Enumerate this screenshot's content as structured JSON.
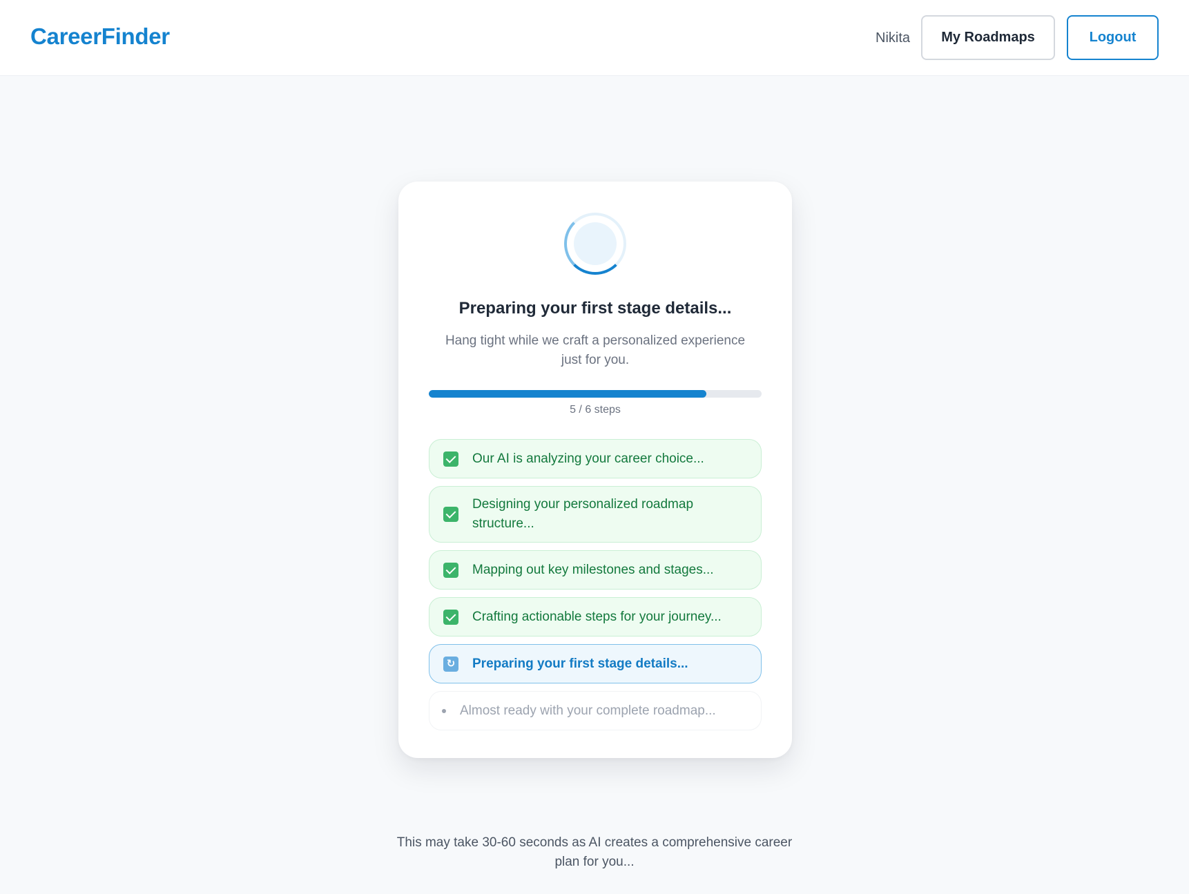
{
  "header": {
    "brand": "CareerFinder",
    "user_name": "Nikita",
    "my_roadmaps_label": "My Roadmaps",
    "logout_label": "Logout"
  },
  "loader": {
    "title": "Preparing your first stage details...",
    "subtitle": "Hang tight while we craft a personalized experience just for you.",
    "progress": {
      "completed": 5,
      "total": 6,
      "fraction": 0.833,
      "label": "5 / 6 steps"
    },
    "steps": [
      {
        "label": "Our AI is analyzing your career choice...",
        "status": "done",
        "icon": "check-icon"
      },
      {
        "label": "Designing your personalized roadmap structure...",
        "status": "done",
        "icon": "check-icon"
      },
      {
        "label": "Mapping out key milestones and stages...",
        "status": "done",
        "icon": "check-icon"
      },
      {
        "label": "Crafting actionable steps for your journey...",
        "status": "done",
        "icon": "check-icon"
      },
      {
        "label": "Preparing your first stage details...",
        "status": "active",
        "icon": "refresh-icon"
      },
      {
        "label": "Almost ready with your complete roadmap...",
        "status": "pending",
        "icon": "bullet-icon"
      }
    ]
  },
  "footer": {
    "note": "This may take 30-60 seconds as AI creates a comprehensive career plan for you..."
  },
  "colors": {
    "brand": "#1583cf",
    "done_text": "#13793d",
    "done_bg": "#eefcf1",
    "active_text": "#137bc4",
    "active_bg": "#eef7fd",
    "pending_text": "#9ca3af"
  }
}
